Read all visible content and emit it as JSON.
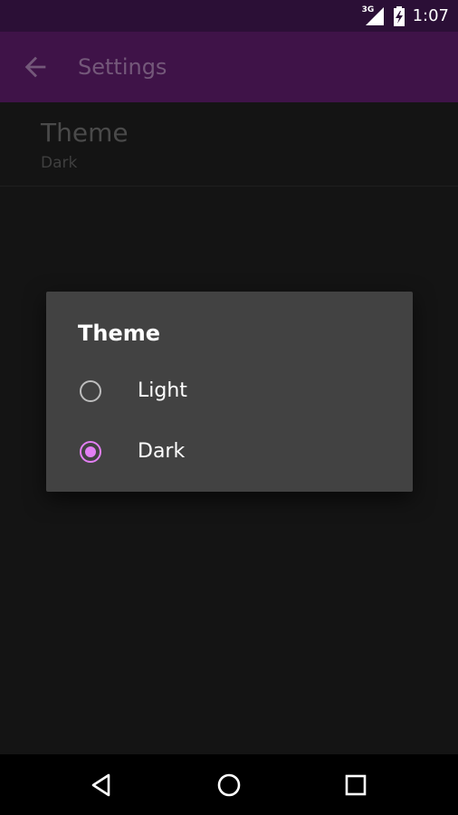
{
  "status_bar": {
    "network_label": "3G",
    "time": "1:07",
    "icons": [
      "signal-icon",
      "battery-charging-icon"
    ]
  },
  "app_bar": {
    "title": "Settings",
    "back_icon": "arrow-back-icon"
  },
  "preference": {
    "title": "Theme",
    "summary": "Dark"
  },
  "dialog": {
    "title": "Theme",
    "options": [
      {
        "label": "Light",
        "checked": false
      },
      {
        "label": "Dark",
        "checked": true
      }
    ]
  },
  "nav_bar": {
    "icons": [
      "back-triangle-icon",
      "home-circle-icon",
      "recents-square-icon"
    ]
  },
  "colors": {
    "status_bar": "#2b0f36",
    "app_bar": "#3f1348",
    "accent": "#e27ff3",
    "dialog_bg": "#424242",
    "background": "#141414"
  }
}
